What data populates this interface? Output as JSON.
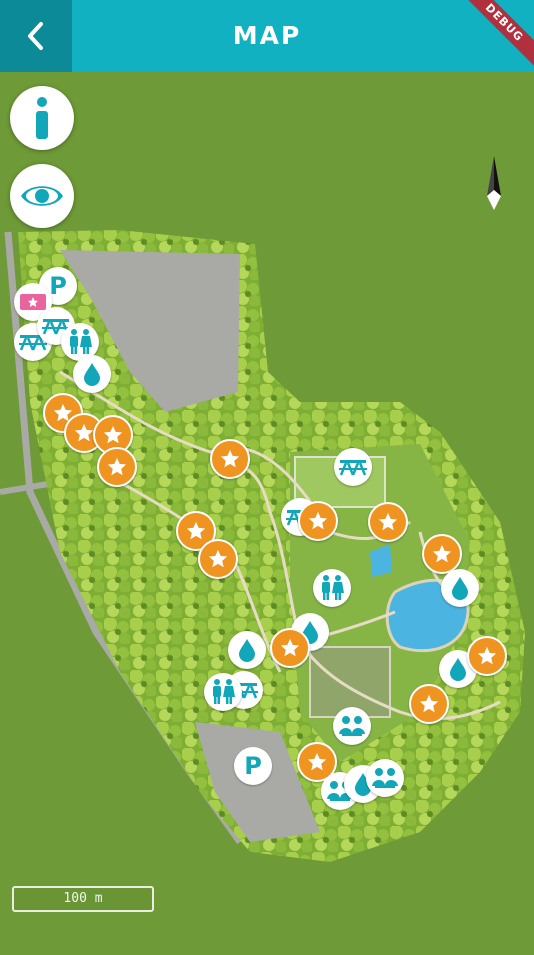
{
  "header": {
    "title": "MAP",
    "back_icon": "chevron-left-icon",
    "debug_banner": "DEBUG",
    "bg_color": "#12b1c2",
    "back_bg_color": "#0d8a98"
  },
  "map": {
    "controls": {
      "info_icon": "info-icon",
      "visibility_icon": "eye-icon",
      "north_icon": "north-arrow-icon"
    },
    "scale_label": "100 m",
    "colors": {
      "grass": "#6e9a37",
      "trees": "#8fbf3e",
      "paths": "#e6dcc4",
      "parking": "#a9aaa6",
      "water": "#4bb4e0",
      "marker_teal": "#12a7b8",
      "marker_orange": "#ef9321"
    },
    "markers": [
      {
        "type": "parking",
        "label": "P"
      },
      {
        "type": "ticket",
        "label": ""
      },
      {
        "type": "picnic",
        "label": ""
      },
      {
        "type": "picnic",
        "label": ""
      },
      {
        "type": "toilets",
        "label": ""
      },
      {
        "type": "water",
        "label": ""
      },
      {
        "type": "attraction",
        "label": ""
      },
      {
        "type": "attraction",
        "label": ""
      },
      {
        "type": "attraction",
        "label": ""
      },
      {
        "type": "attraction",
        "label": ""
      },
      {
        "type": "attraction",
        "label": ""
      },
      {
        "type": "attraction",
        "label": ""
      },
      {
        "type": "attraction",
        "label": ""
      },
      {
        "type": "picnic",
        "label": ""
      },
      {
        "type": "picnic",
        "label": ""
      },
      {
        "type": "attraction",
        "label": ""
      },
      {
        "type": "attraction",
        "label": ""
      },
      {
        "type": "attraction",
        "label": ""
      },
      {
        "type": "water",
        "label": ""
      },
      {
        "type": "toilets",
        "label": ""
      },
      {
        "type": "water",
        "label": ""
      },
      {
        "type": "water",
        "label": ""
      },
      {
        "type": "attraction",
        "label": ""
      },
      {
        "type": "water",
        "label": ""
      },
      {
        "type": "attraction",
        "label": ""
      },
      {
        "type": "picnic",
        "label": ""
      },
      {
        "type": "toilets",
        "label": ""
      },
      {
        "type": "attraction",
        "label": ""
      },
      {
        "type": "group",
        "label": ""
      },
      {
        "type": "parking",
        "label": "P"
      },
      {
        "type": "attraction",
        "label": ""
      },
      {
        "type": "group",
        "label": ""
      },
      {
        "type": "water",
        "label": ""
      },
      {
        "type": "group",
        "label": ""
      }
    ]
  }
}
